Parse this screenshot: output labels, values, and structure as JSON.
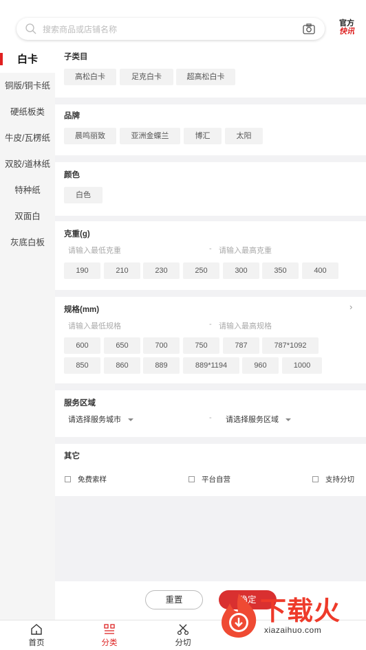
{
  "search": {
    "placeholder": "搜索商品或店铺名称"
  },
  "official": {
    "line1": "官方",
    "line2": "快讯"
  },
  "sidebar": {
    "items": [
      {
        "label": "白卡"
      },
      {
        "label": "铜版/铜卡纸"
      },
      {
        "label": "硬纸板类"
      },
      {
        "label": "牛皮/瓦楞纸"
      },
      {
        "label": "双胶/道林纸"
      },
      {
        "label": "特种纸"
      },
      {
        "label": "双面白"
      },
      {
        "label": "灰底白板"
      }
    ]
  },
  "filters": {
    "subcategory": {
      "title": "子类目",
      "options": [
        "高松白卡",
        "足克白卡",
        "超高松白卡"
      ]
    },
    "brand": {
      "title": "品牌",
      "options": [
        "晨鸣丽致",
        "亚洲金蝶兰",
        "博汇",
        "太阳"
      ]
    },
    "color": {
      "title": "颜色",
      "options": [
        "白色"
      ]
    },
    "weight": {
      "title": "克重(g)",
      "min_placeholder": "请输入最低克重",
      "max_placeholder": "请输入最高克重",
      "separator": "-",
      "options": [
        "190",
        "210",
        "230",
        "250",
        "300",
        "350",
        "400"
      ]
    },
    "spec": {
      "title": "规格(mm)",
      "chevron": "›",
      "min_placeholder": "请输入最低规格",
      "max_placeholder": "请输入最高规格",
      "separator": "-",
      "options_row1": [
        "600",
        "650",
        "700",
        "750",
        "787",
        "787*1092"
      ],
      "options_row2": [
        "850",
        "860",
        "889",
        "889*1194",
        "960",
        "1000"
      ]
    },
    "service_area": {
      "title": "服务区域",
      "city_select": "请选择服务城市",
      "area_select": "请选择服务区域",
      "separator": "-"
    },
    "other": {
      "title": "其它",
      "options": [
        "免费索样",
        "平台自营",
        "支持分切"
      ]
    }
  },
  "actions": {
    "reset_label": "重置",
    "confirm_label": "确定"
  },
  "bottom_nav": {
    "items": [
      {
        "label": "首页",
        "icon": "home-icon"
      },
      {
        "label": "分类",
        "icon": "category-icon"
      },
      {
        "label": "分切",
        "icon": "scissors-icon"
      }
    ]
  },
  "watermark": {
    "text": "下载火",
    "sub": "xiazaihuo.com"
  },
  "colors": {
    "accent": "#d93030",
    "chip_bg": "#f2f2f2",
    "sidebar_bg": "#f5f5f5"
  }
}
